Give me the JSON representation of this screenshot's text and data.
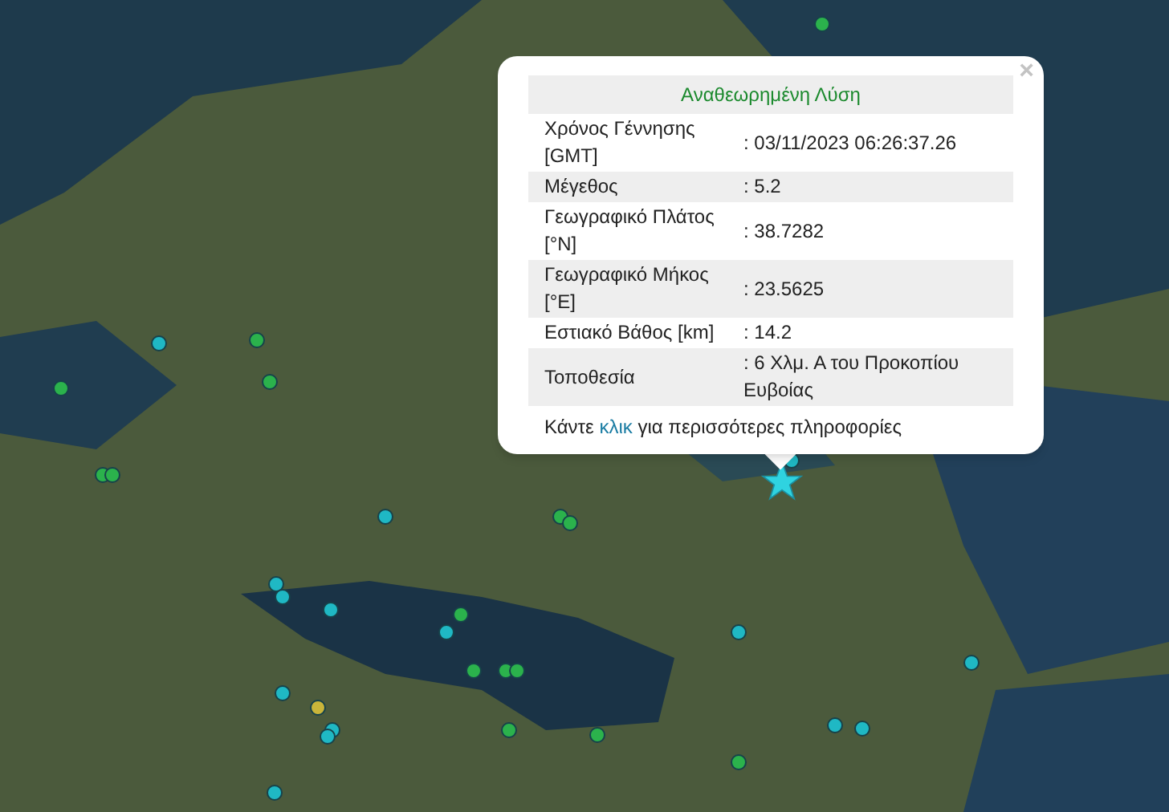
{
  "popup": {
    "title": "Αναθεωρημένη Λύση",
    "close": "×",
    "rows": [
      {
        "label": "Χρόνος Γέννησης [GMT]",
        "value": ": 03/11/2023 06:26:37.26"
      },
      {
        "label": "Μέγεθος",
        "value": ": 5.2"
      },
      {
        "label": "Γεωγραφικό Πλάτος [°N]",
        "value": ": 38.7282"
      },
      {
        "label": "Γεωγραφικό Μήκος [°E]",
        "value": ": 23.5625"
      },
      {
        "label": "Εστιακό Βάθος [km]",
        "value": ": 14.2"
      },
      {
        "label": "Τοποθεσία",
        "value": ": 6 Χλμ. Α του Προκοπίου Ευβοίας"
      }
    ],
    "footer": {
      "before": "Κάντε ",
      "link": "κλικ",
      "after": " για περισσότερες πληροφορίες"
    }
  },
  "markers": [
    {
      "color": "#1fb8c4"
    },
    {
      "color": "#1fb8c4"
    },
    {
      "color": "#1fb8c4"
    },
    {
      "color": "#1fb8c4"
    },
    {
      "color": "#1fb8c4"
    },
    {
      "color": "#1fb8c4"
    },
    {
      "color": "#1fb8c4"
    },
    {
      "color": "#1fb8c4"
    },
    {
      "color": "#1fb8c4"
    },
    {
      "color": "#1fb8c4"
    },
    {
      "color": "#1fb8c4"
    },
    {
      "color": "#1fb8c4"
    },
    {
      "color": "#1fb8c4"
    },
    {
      "color": "#1fb8c4"
    },
    {
      "color": "#1fb8c4"
    },
    {
      "color": "#2bb24c"
    },
    {
      "color": "#2bb24c"
    },
    {
      "color": "#2bb24c"
    },
    {
      "color": "#2bb24c"
    },
    {
      "color": "#2bb24c"
    },
    {
      "color": "#2bb24c"
    },
    {
      "color": "#2bb24c"
    },
    {
      "color": "#2bb24c"
    },
    {
      "color": "#2bb24c"
    },
    {
      "color": "#2bb24c"
    },
    {
      "color": "#2bb24c"
    },
    {
      "color": "#2bb24c"
    },
    {
      "color": "#2bb24c"
    },
    {
      "color": "#2bb24c"
    },
    {
      "color": "#2bb24c"
    },
    {
      "color": "#c9b53a"
    }
  ]
}
